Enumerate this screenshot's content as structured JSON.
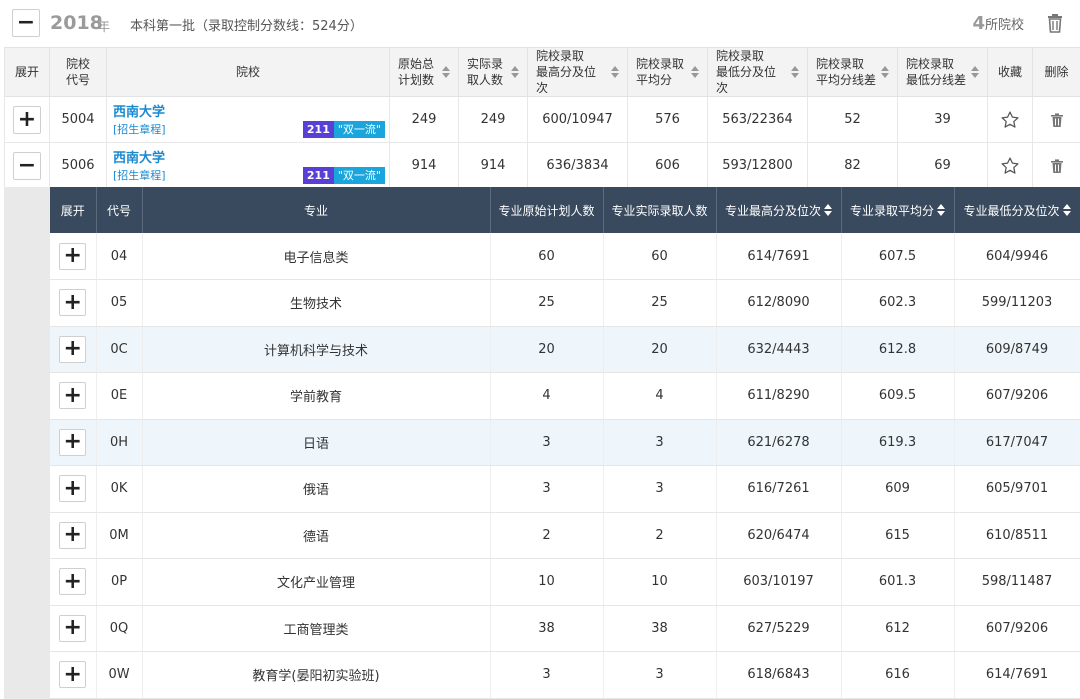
{
  "header": {
    "toggle": "−",
    "year": "2018",
    "year_suffix": "年",
    "batch_text": "本科第一批（录取控制分数线：524分）",
    "school_count": "4",
    "school_count_suffix": "所院校"
  },
  "outer_table": {
    "columns": {
      "expand": "展开",
      "code_1": "院校",
      "code_2": "代号",
      "university": "院校",
      "plan_1": "原始总",
      "plan_2": "计划数",
      "admit_1": "实际录",
      "admit_2": "取人数",
      "max_1": "院校录取",
      "max_2": "最高分及位次",
      "avg_1": "院校录取",
      "avg_2": "平均分",
      "min_1": "院校录取",
      "min_2": "最低分及位次",
      "avgdiff_1": "院校录取",
      "avgdiff_2": "平均分线差",
      "mindiff_1": "院校录取",
      "mindiff_2": "最低分线差",
      "fav": "收藏",
      "del": "删除"
    },
    "rows": [
      {
        "toggle": "+",
        "code": "5004",
        "name": "西南大学",
        "link": "[招生章程]",
        "tag1": "211",
        "tag2": "\"双一流\"",
        "plan": "249",
        "admitted": "249",
        "max": "600/10947",
        "avg": "576",
        "min": "563/22364",
        "avg_diff": "52",
        "min_diff": "39"
      },
      {
        "toggle": "−",
        "code": "5006",
        "name": "西南大学",
        "link": "[招生章程]",
        "tag1": "211",
        "tag2": "\"双一流\"",
        "plan": "914",
        "admitted": "914",
        "max": "636/3834",
        "avg": "606",
        "min": "593/12800",
        "avg_diff": "82",
        "min_diff": "69"
      }
    ]
  },
  "inner_table": {
    "columns": {
      "expand": "展开",
      "code": "代号",
      "major": "专业",
      "plan": "专业原始计划人数",
      "admitted": "专业实际录取人数",
      "max": "专业最高分及位次",
      "avg": "专业录取平均分",
      "min": "专业最低分及位次"
    },
    "rows": [
      {
        "toggle": "+",
        "code": "04",
        "major": "电子信息类",
        "plan": "60",
        "admitted": "60",
        "max": "614/7691",
        "avg": "607.5",
        "min": "604/9946"
      },
      {
        "toggle": "+",
        "code": "05",
        "major": "生物技术",
        "plan": "25",
        "admitted": "25",
        "max": "612/8090",
        "avg": "602.3",
        "min": "599/11203"
      },
      {
        "toggle": "+",
        "code": "0C",
        "major": "计算机科学与技术",
        "plan": "20",
        "admitted": "20",
        "max": "632/4443",
        "avg": "612.8",
        "min": "609/8749"
      },
      {
        "toggle": "+",
        "code": "0E",
        "major": "学前教育",
        "plan": "4",
        "admitted": "4",
        "max": "611/8290",
        "avg": "609.5",
        "min": "607/9206"
      },
      {
        "toggle": "+",
        "code": "0H",
        "major": "日语",
        "plan": "3",
        "admitted": "3",
        "max": "621/6278",
        "avg": "619.3",
        "min": "617/7047"
      },
      {
        "toggle": "+",
        "code": "0K",
        "major": "俄语",
        "plan": "3",
        "admitted": "3",
        "max": "616/7261",
        "avg": "609",
        "min": "605/9701"
      },
      {
        "toggle": "+",
        "code": "0M",
        "major": "德语",
        "plan": "2",
        "admitted": "2",
        "max": "620/6474",
        "avg": "615",
        "min": "610/8511"
      },
      {
        "toggle": "+",
        "code": "0P",
        "major": "文化产业管理",
        "plan": "10",
        "admitted": "10",
        "max": "603/10197",
        "avg": "601.3",
        "min": "598/11487"
      },
      {
        "toggle": "+",
        "code": "0Q",
        "major": "工商管理类",
        "plan": "38",
        "admitted": "38",
        "max": "627/5229",
        "avg": "612",
        "min": "607/9206"
      },
      {
        "toggle": "+",
        "code": "0W",
        "major": "教育学(晏阳初实验班)",
        "plan": "3",
        "admitted": "3",
        "max": "618/6843",
        "avg": "616",
        "min": "614/7691"
      }
    ]
  },
  "colors": {
    "link": "#1a8ad0",
    "tag_211": "#5a3fd6",
    "tag_double_first": "#1aa6dc",
    "inner_header_bg": "#3a4a5e",
    "highlight_row": "#eef6fb"
  }
}
